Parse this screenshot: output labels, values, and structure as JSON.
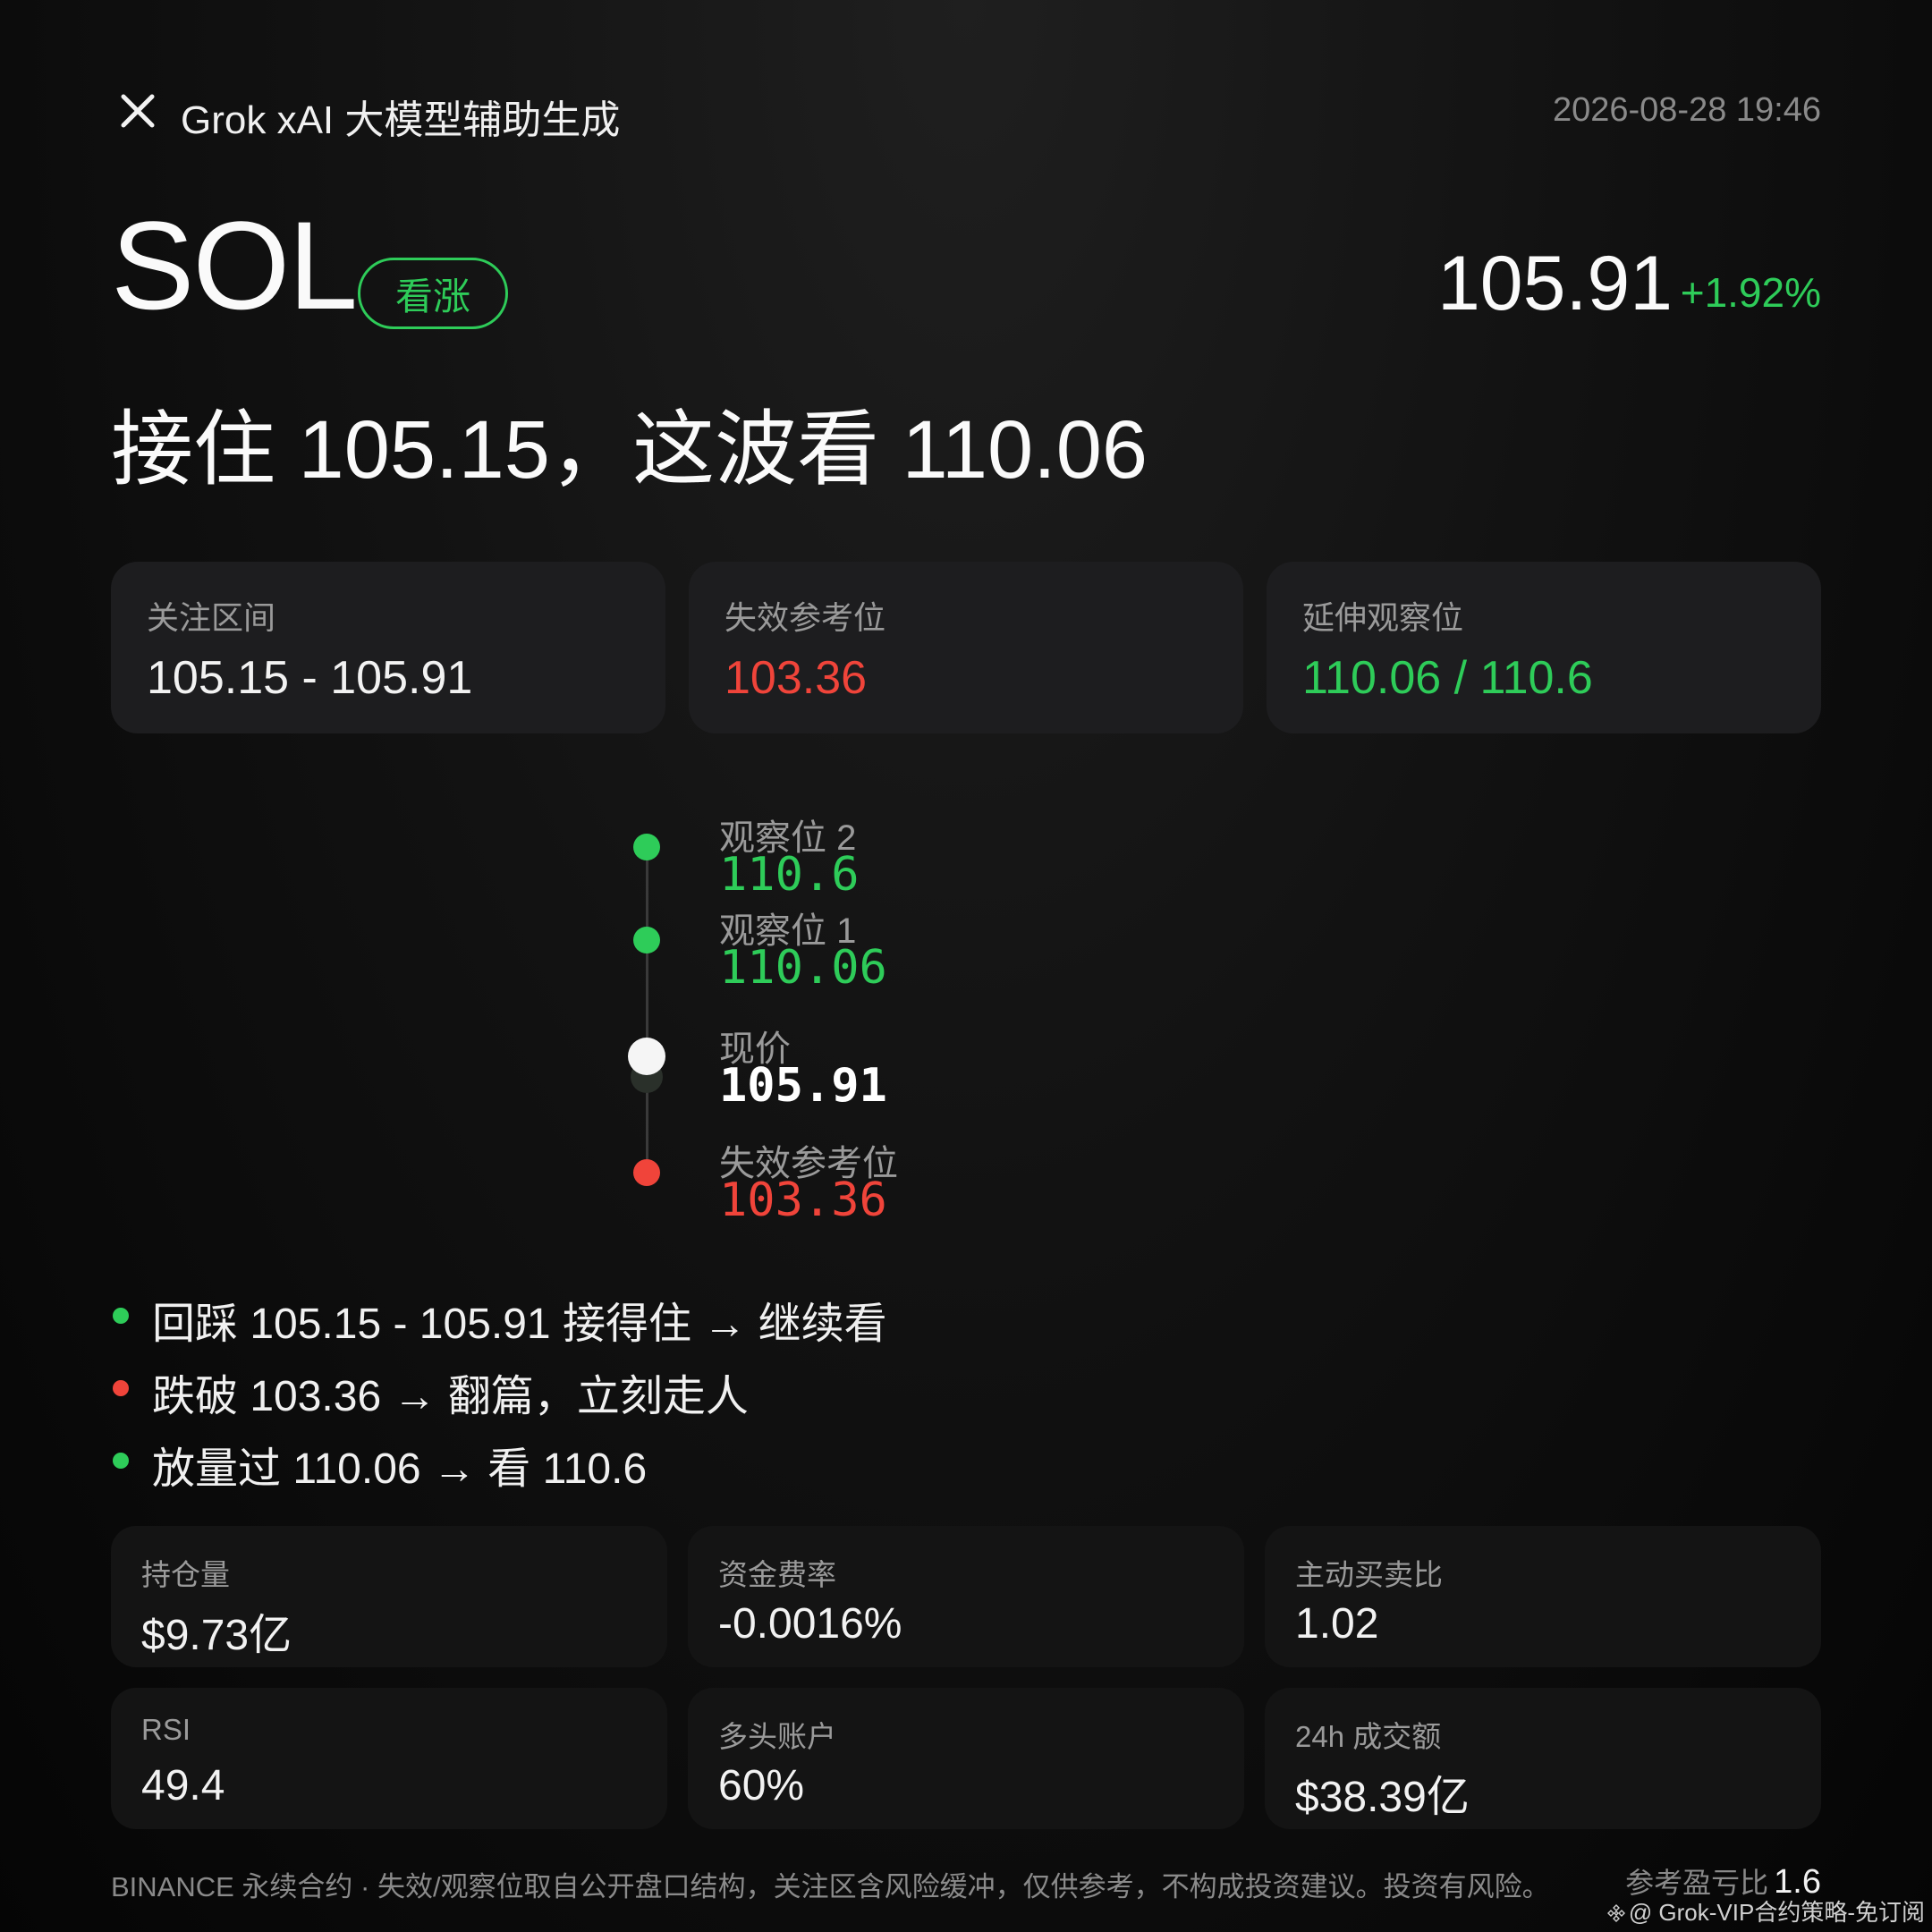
{
  "header": {
    "source_label": "Grok xAI 大模型辅助生成",
    "timestamp": "2026-08-28 19:46"
  },
  "asset": {
    "symbol": "SOL",
    "sentiment": "看涨",
    "price": "105.91",
    "change": "+1.92%"
  },
  "headline": "接住 105.15，这波看 110.06",
  "summary_cards": [
    {
      "label": "关注区间",
      "value": "105.15 - 105.91"
    },
    {
      "label": "失效参考位",
      "value": "103.36"
    },
    {
      "label": "延伸观察位",
      "value": "110.06 / 110.6"
    }
  ],
  "ladder": [
    {
      "label": "观察位 2",
      "value": "110.6"
    },
    {
      "label": "观察位 1",
      "value": "110.06"
    },
    {
      "label": "现价",
      "value": "105.91"
    },
    {
      "label": "失效参考位",
      "value": "103.36"
    }
  ],
  "rules": [
    "回踩 105.15 - 105.91 接得住 → 继续看",
    "跌破 103.36 → 翻篇，立刻走人",
    "放量过 110.06 → 看 110.6"
  ],
  "stats": [
    {
      "label": "持仓量",
      "value": "$9.73亿"
    },
    {
      "label": "资金费率",
      "value": "-0.0016%"
    },
    {
      "label": "主动买卖比",
      "value": "1.02"
    },
    {
      "label": "RSI",
      "value": "49.4"
    },
    {
      "label": "多头账户",
      "value": "60%"
    },
    {
      "label": "24h 成交额",
      "value": "$38.39亿"
    }
  ],
  "footer": {
    "disclaimer": "BINANCE 永续合约 · 失效/观察位取自公开盘口结构，关注区含风险缓冲，仅供参考，不构成投资建议。投资有风险。",
    "rr_label": "参考盈亏比",
    "rr_value": "1.6",
    "watermark": "@ Grok-VIP合约策略-免订阅"
  },
  "colors": {
    "bullish": "#2ecc59",
    "bearish": "#f0443a",
    "text": "#f2f2f2",
    "muted": "#9a9a9a"
  }
}
